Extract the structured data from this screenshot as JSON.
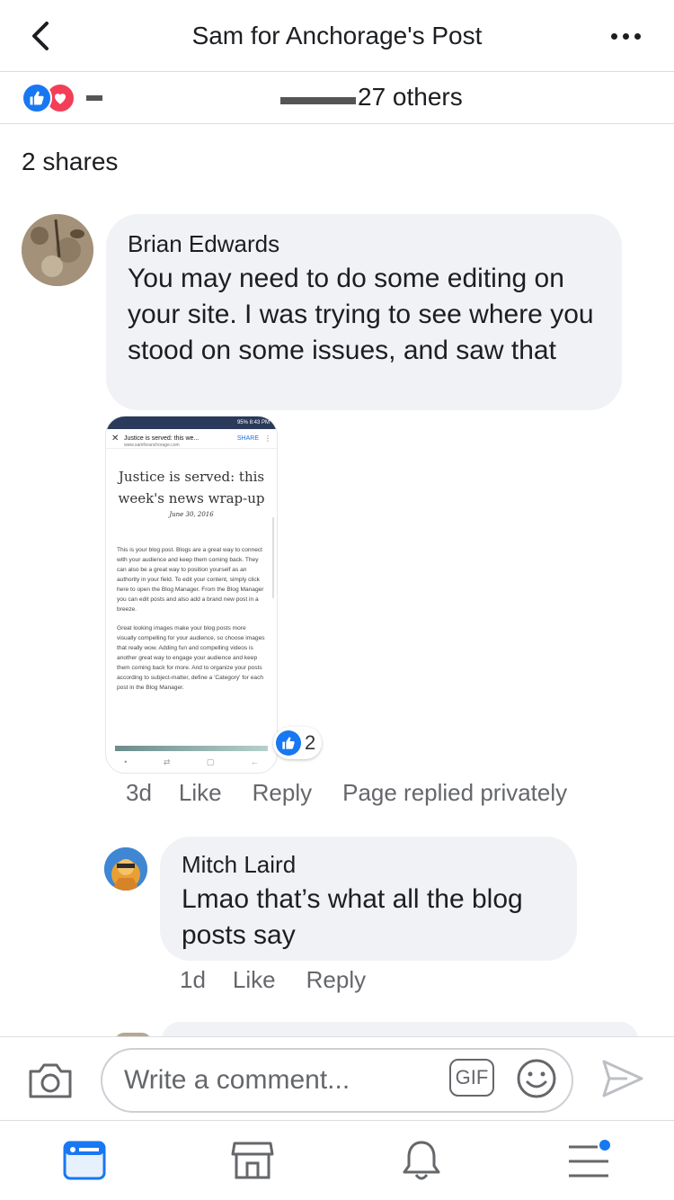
{
  "header": {
    "title": "Sam for Anchorage's Post"
  },
  "reactions": {
    "others_text": "27 others"
  },
  "shares": {
    "label": "2 shares"
  },
  "comments": [
    {
      "author": "Brian Edwards",
      "text": "You may need to do some editing on your site. I was trying to see where you stood on some issues, and saw that",
      "attachment": {
        "status_time": "95% 8:43 PM",
        "bar_title": "Justice is served: this we...",
        "share_label": "SHARE",
        "url": "www.samforanchorage.com",
        "heading": "Justice is served: this week's news wrap-up",
        "date": "June 30, 2016",
        "para1": "This is your blog post. Blogs are a great way to connect with your audience and keep them coming back. They can also be a great way to position yourself as an authority in your field. To edit your content, simply click here to open the Blog Manager. From the Blog Manager you can edit posts and also add a brand new post in a breeze.",
        "para2": "Great looking images make your blog posts more visually compelling for your audience, so choose images that really wow. Adding fun and compelling videos is another great way to engage your audience and keep them coming back for more. And to organize your posts according to subject-matter, define a 'Category' for each post in the Blog Manager."
      },
      "like_count": "2",
      "time": "3d",
      "like_label": "Like",
      "reply_label": "Reply",
      "note": "Page replied privately"
    },
    {
      "author": "Mitch Laird",
      "text": "Lmao that’s what all the blog posts say",
      "time": "1d",
      "like_label": "Like",
      "reply_label": "Reply"
    }
  ],
  "composer": {
    "placeholder": "Write a comment...",
    "gif_label": "GIF"
  },
  "icons": {
    "back": "chevron-left-icon",
    "more": "more-dots-icon",
    "camera": "camera-icon",
    "emoji": "smiley-icon",
    "send": "send-icon",
    "tabs": [
      "news-feed-icon",
      "marketplace-icon",
      "notifications-bell-icon",
      "menu-icon"
    ]
  },
  "colors": {
    "accent": "#1877f2",
    "love": "#f33e58",
    "bubble": "#f0f2f5",
    "secondary_text": "#65676b"
  }
}
